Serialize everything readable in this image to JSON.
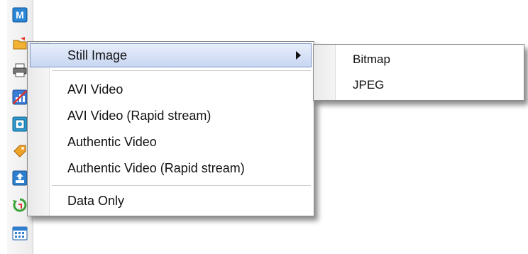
{
  "toolbar": {
    "icons": [
      {
        "name": "m-logo-icon",
        "glyph": "M"
      },
      {
        "name": "open-folder-icon"
      },
      {
        "name": "printer-icon"
      },
      {
        "name": "disabled-chart-icon"
      },
      {
        "name": "capture-icon"
      },
      {
        "name": "tag-icon"
      },
      {
        "name": "export-icon"
      },
      {
        "name": "refresh-icon"
      },
      {
        "name": "calendar-icon"
      }
    ]
  },
  "menu": {
    "items": [
      {
        "label": "Still Image",
        "has_submenu": true,
        "highlighted": true
      },
      {
        "label": "AVI Video"
      },
      {
        "label": "AVI Video (Rapid stream)"
      },
      {
        "label": "Authentic Video"
      },
      {
        "label": "Authentic Video (Rapid stream)"
      },
      {
        "label": "Data Only"
      }
    ]
  },
  "submenu": {
    "items": [
      {
        "label": "Bitmap"
      },
      {
        "label": "JPEG"
      }
    ]
  },
  "colors": {
    "highlight_border": "#7e95c8",
    "highlight_fill": "#c8d6f2",
    "menu_border": "#8a8a8a"
  }
}
